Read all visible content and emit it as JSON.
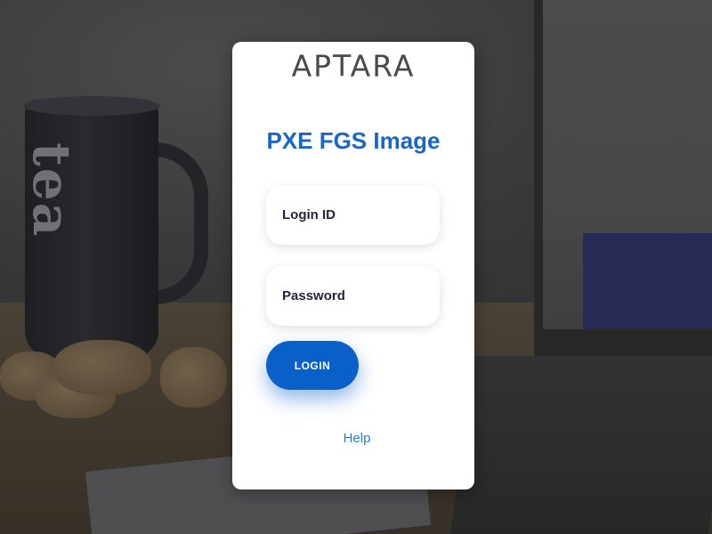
{
  "brand": {
    "logo_text": "APTARA",
    "logo_color": "#4a4a4a"
  },
  "app": {
    "title": "PXE FGS Image",
    "title_color": "#1a66c8"
  },
  "form": {
    "login_placeholder": "Login ID",
    "login_value": "",
    "password_placeholder": "Password",
    "password_value": "",
    "login_button_label": "LOGIN",
    "button_color": "#0a5fc8"
  },
  "footer": {
    "help_label": "Help",
    "help_color": "#2b7cd3"
  },
  "background": {
    "mug_text": "tea"
  }
}
